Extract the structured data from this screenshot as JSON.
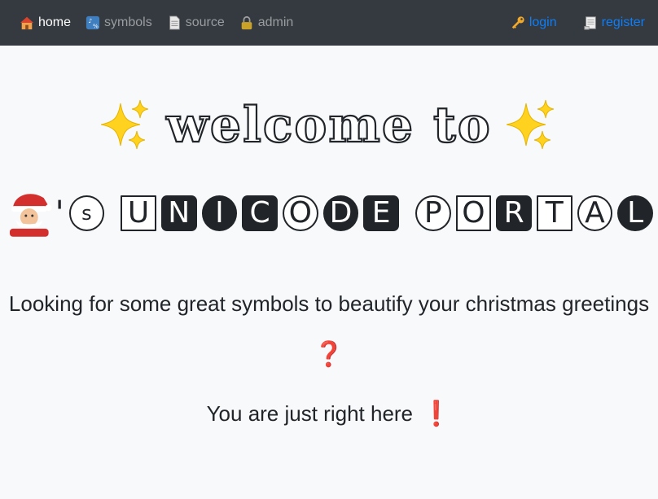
{
  "navbar": {
    "left": [
      {
        "label": "home",
        "icon": "house-icon",
        "active": true
      },
      {
        "label": "symbols",
        "icon": "symbols-icon",
        "active": false
      },
      {
        "label": "source",
        "icon": "page-icon",
        "active": false
      },
      {
        "label": "admin",
        "icon": "lock-icon",
        "active": false
      }
    ],
    "right": [
      {
        "label": "login",
        "icon": "key-icon"
      },
      {
        "label": "register",
        "icon": "scroll-icon"
      }
    ]
  },
  "hero": {
    "welcome_text": "welcome to",
    "sparkle_icon": "sparkles-icon",
    "santa_icon": "santa-icon",
    "apostrophe": "'",
    "possessive_letter": "s",
    "word1": [
      "U",
      "N",
      "I",
      "C",
      "O",
      "D",
      "E"
    ],
    "word2": [
      "P",
      "O",
      "R",
      "T",
      "A",
      "L"
    ]
  },
  "tagline": {
    "text": "Looking for some great symbols to beautify your christmas greetings",
    "question_mark": "❓"
  },
  "subline": {
    "text": "You are just right here",
    "exclamation": "❗"
  },
  "colors": {
    "navbar_bg": "#343a40",
    "link_blue": "#0d7efa",
    "accent_red": "#e53935",
    "page_bg": "#f8f9fa"
  }
}
